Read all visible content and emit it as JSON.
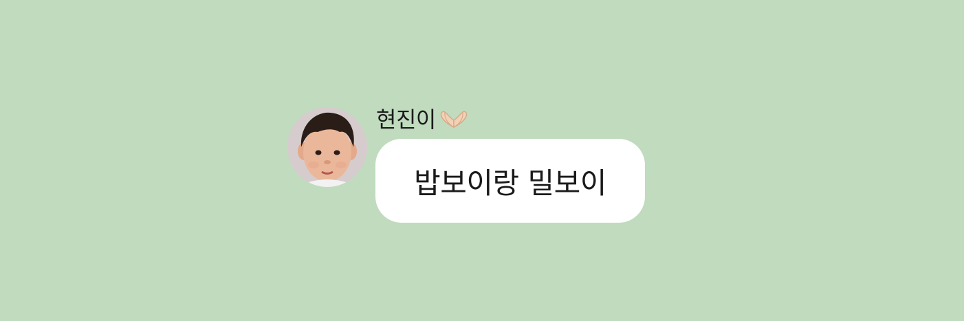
{
  "background_color": "#c0dbbe",
  "message": {
    "sender": {
      "name": "현진이",
      "emoji_icon": "heart-hands-icon"
    },
    "avatar_icon": "child-photo-avatar",
    "text": "밥보이랑 밀보이",
    "bubble_color": "#ffffff"
  }
}
